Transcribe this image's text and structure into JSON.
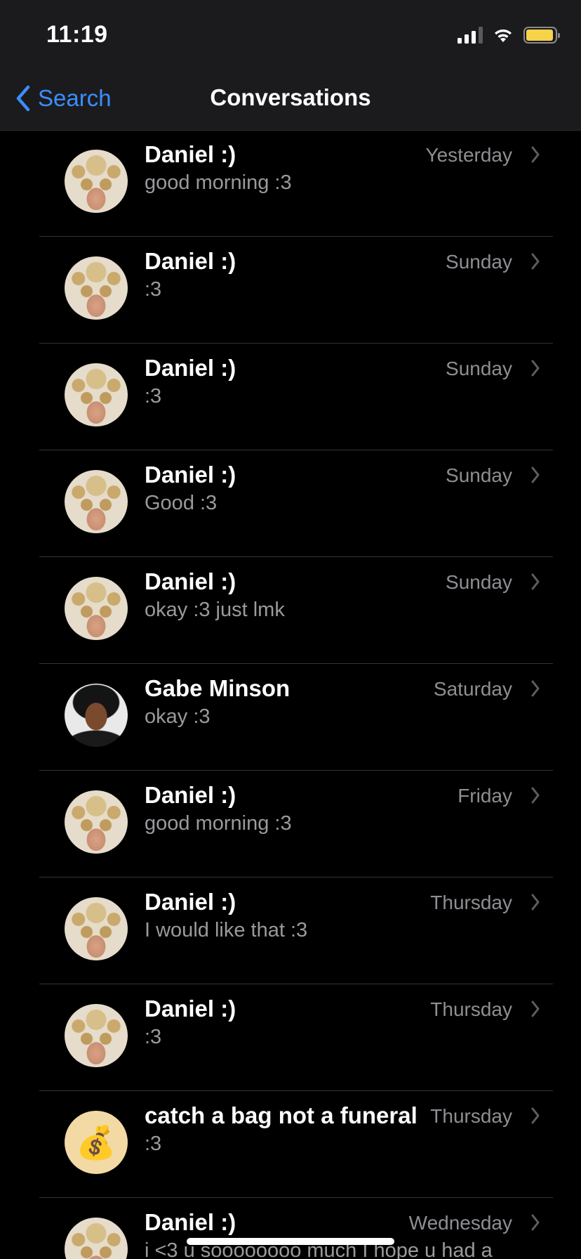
{
  "status_bar": {
    "time": "11:19",
    "signal_icon": "cellular-signal-icon",
    "wifi_icon": "wifi-icon",
    "battery_icon": "battery-icon",
    "battery_color": "#f7d34a",
    "battery_level": 0.95
  },
  "nav": {
    "back_icon": "chevron-left-icon",
    "back_label": "Search",
    "title": "Conversations",
    "accent_color": "#3b8eff"
  },
  "conversations": [
    {
      "name": "Daniel :)",
      "preview": "good morning :3",
      "time": "Yesterday",
      "avatar": "daniel"
    },
    {
      "name": "Daniel :)",
      "preview": ":3",
      "time": "Sunday",
      "avatar": "daniel"
    },
    {
      "name": "Daniel :)",
      "preview": ":3",
      "time": "Sunday",
      "avatar": "daniel"
    },
    {
      "name": "Daniel :)",
      "preview": "Good :3",
      "time": "Sunday",
      "avatar": "daniel"
    },
    {
      "name": "Daniel :)",
      "preview": "okay :3 just lmk",
      "time": "Sunday",
      "avatar": "daniel"
    },
    {
      "name": "Gabe Minson",
      "preview": "okay :3",
      "time": "Saturday",
      "avatar": "gabe"
    },
    {
      "name": "Daniel :)",
      "preview": "good morning :3",
      "time": "Friday",
      "avatar": "daniel"
    },
    {
      "name": "Daniel :)",
      "preview": "I would like that :3",
      "time": "Thursday",
      "avatar": "daniel"
    },
    {
      "name": "Daniel :)",
      "preview": ":3",
      "time": "Thursday",
      "avatar": "daniel"
    },
    {
      "name": "catch a bag not a funeral",
      "preview": ":3",
      "time": "Thursday",
      "avatar": "moneybag",
      "avatar_glyph": "💰"
    },
    {
      "name": "Daniel :)",
      "preview": "i <3 u soooooooo much I hope u had a",
      "time": "Wednesday",
      "avatar": "daniel"
    }
  ]
}
